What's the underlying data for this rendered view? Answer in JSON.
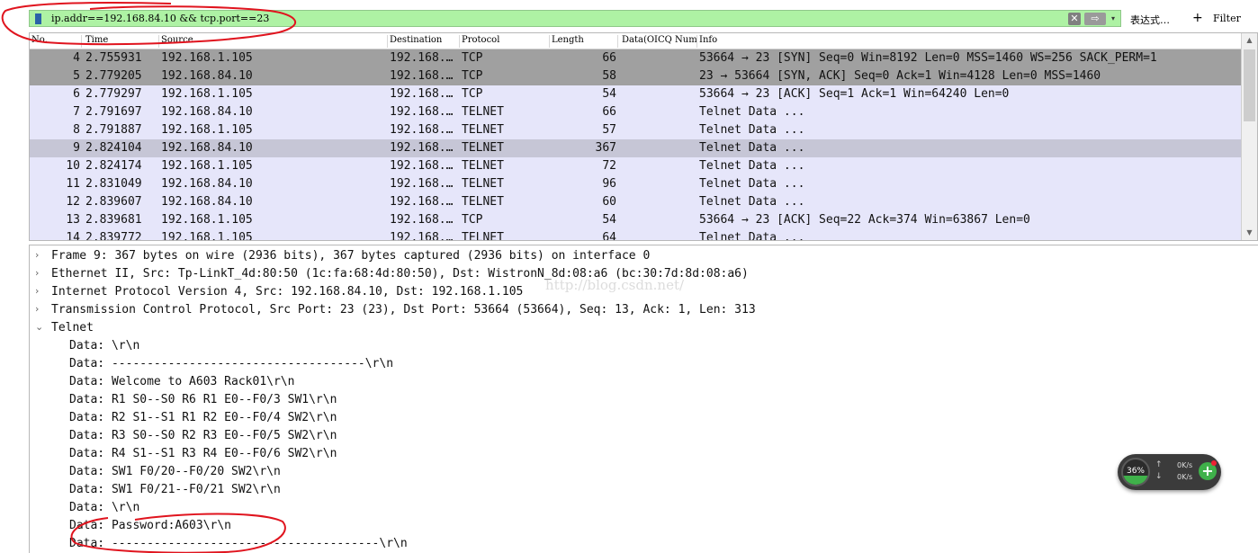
{
  "filter": {
    "value": "ip.addr==192.168.84.10 && tcp.port==23",
    "clear_icon": "✕",
    "apply_icon": "⇨",
    "dropdown_icon": "▾",
    "expression_label": "表达式…",
    "plus_label": "+",
    "filter_label": "Filter"
  },
  "packet_list": {
    "columns": [
      "No.",
      "Time",
      "Source",
      "Destination",
      "Protocol",
      "Length",
      "Data(OICQ Num",
      "Info"
    ],
    "rows": [
      {
        "no": "4",
        "time": "2.755931",
        "src": "192.168.1.105",
        "dst": "192.168.…",
        "proto": "TCP",
        "len": "66",
        "info": "53664 → 23 [SYN] Seq=0 Win=8192 Len=0 MSS=1460 WS=256 SACK_PERM=1",
        "style": "tcp-dark"
      },
      {
        "no": "5",
        "time": "2.779205",
        "src": "192.168.84.10",
        "dst": "192.168.…",
        "proto": "TCP",
        "len": "58",
        "info": "23 → 53664 [SYN, ACK] Seq=0 Ack=1 Win=4128 Len=0 MSS=1460",
        "style": "tcp-dark"
      },
      {
        "no": "6",
        "time": "2.779297",
        "src": "192.168.1.105",
        "dst": "192.168.…",
        "proto": "TCP",
        "len": "54",
        "info": "53664 → 23 [ACK] Seq=1 Ack=1 Win=64240 Len=0",
        "style": "normal"
      },
      {
        "no": "7",
        "time": "2.791697",
        "src": "192.168.84.10",
        "dst": "192.168.…",
        "proto": "TELNET",
        "len": "66",
        "info": "Telnet Data ...",
        "style": "normal"
      },
      {
        "no": "8",
        "time": "2.791887",
        "src": "192.168.1.105",
        "dst": "192.168.…",
        "proto": "TELNET",
        "len": "57",
        "info": "Telnet Data ...",
        "style": "normal"
      },
      {
        "no": "9",
        "time": "2.824104",
        "src": "192.168.84.10",
        "dst": "192.168.…",
        "proto": "TELNET",
        "len": "367",
        "info": "Telnet Data ...",
        "style": "selected"
      },
      {
        "no": "10",
        "time": "2.824174",
        "src": "192.168.1.105",
        "dst": "192.168.…",
        "proto": "TELNET",
        "len": "72",
        "info": "Telnet Data ...",
        "style": "normal"
      },
      {
        "no": "11",
        "time": "2.831049",
        "src": "192.168.84.10",
        "dst": "192.168.…",
        "proto": "TELNET",
        "len": "96",
        "info": "Telnet Data ...",
        "style": "normal"
      },
      {
        "no": "12",
        "time": "2.839607",
        "src": "192.168.84.10",
        "dst": "192.168.…",
        "proto": "TELNET",
        "len": "60",
        "info": "Telnet Data ...",
        "style": "normal"
      },
      {
        "no": "13",
        "time": "2.839681",
        "src": "192.168.1.105",
        "dst": "192.168.…",
        "proto": "TCP",
        "len": "54",
        "info": "53664 → 23 [ACK] Seq=22 Ack=374 Win=63867 Len=0",
        "style": "normal"
      },
      {
        "no": "14",
        "time": "2.839772",
        "src": "192.168.1.105",
        "dst": "192.168.…",
        "proto": "TELNET",
        "len": "64",
        "info": "Telnet Data ...",
        "style": "normal"
      }
    ],
    "scroll_up_icon": "▲",
    "scroll_down_icon": "▼",
    "colors": {
      "tcp_dark": "#a0a0a0",
      "normal": "#e6e6fa",
      "selected": "#c6c6d6"
    }
  },
  "details": {
    "lines": [
      {
        "arrow": "›",
        "text": "Frame 9: 367 bytes on wire (2936 bits), 367 bytes captured (2936 bits) on interface 0",
        "sub": false
      },
      {
        "arrow": "›",
        "text": "Ethernet II, Src: Tp-LinkT_4d:80:50 (1c:fa:68:4d:80:50), Dst: WistronN_8d:08:a6 (bc:30:7d:8d:08:a6)",
        "sub": false
      },
      {
        "arrow": "›",
        "text": "Internet Protocol Version 4, Src: 192.168.84.10, Dst: 192.168.1.105",
        "sub": false
      },
      {
        "arrow": "›",
        "text": "Transmission Control Protocol, Src Port: 23 (23), Dst Port: 53664 (53664), Seq: 13, Ack: 1, Len: 313",
        "sub": false
      },
      {
        "arrow": "⌄",
        "text": "Telnet",
        "sub": false
      },
      {
        "arrow": "",
        "text": "Data: \\r\\n",
        "sub": true
      },
      {
        "arrow": "",
        "text": "Data: ------------------------------------\\r\\n",
        "sub": true
      },
      {
        "arrow": "",
        "text": "Data: Welcome to A603 Rack01\\r\\n",
        "sub": true
      },
      {
        "arrow": "",
        "text": "Data: R1  S0--S0   R6    R1  E0--F0/3 SW1\\r\\n",
        "sub": true
      },
      {
        "arrow": "",
        "text": "Data: R2  S1--S1   R1    R2  E0--F0/4 SW2\\r\\n",
        "sub": true
      },
      {
        "arrow": "",
        "text": "Data: R3  S0--S0   R2    R3  E0--F0/5 SW2\\r\\n",
        "sub": true
      },
      {
        "arrow": "",
        "text": "Data: R4  S1--S1   R3    R4  E0--F0/6 SW2\\r\\n",
        "sub": true
      },
      {
        "arrow": "",
        "text": "Data: SW1 F0/20--F0/20 SW2\\r\\n",
        "sub": true
      },
      {
        "arrow": "",
        "text": "Data: SW1 F0/21--F0/21 SW2\\r\\n",
        "sub": true
      },
      {
        "arrow": "",
        "text": "Data: \\r\\n",
        "sub": true
      },
      {
        "arrow": "",
        "text": "Data: Password:A603\\r\\n",
        "sub": true
      },
      {
        "arrow": "",
        "text": "Data: --------------------------------------\\r\\n",
        "sub": true
      }
    ]
  },
  "watermark": "http://blog.csdn.net/",
  "net_widget": {
    "percent": "36%",
    "percent_value": 0.36,
    "up_icon": "↑",
    "down_icon": "↓",
    "up_speed": "0K/s",
    "down_speed": "0K/s",
    "plus_icon": "+"
  },
  "annotation_color": "#e0141e"
}
